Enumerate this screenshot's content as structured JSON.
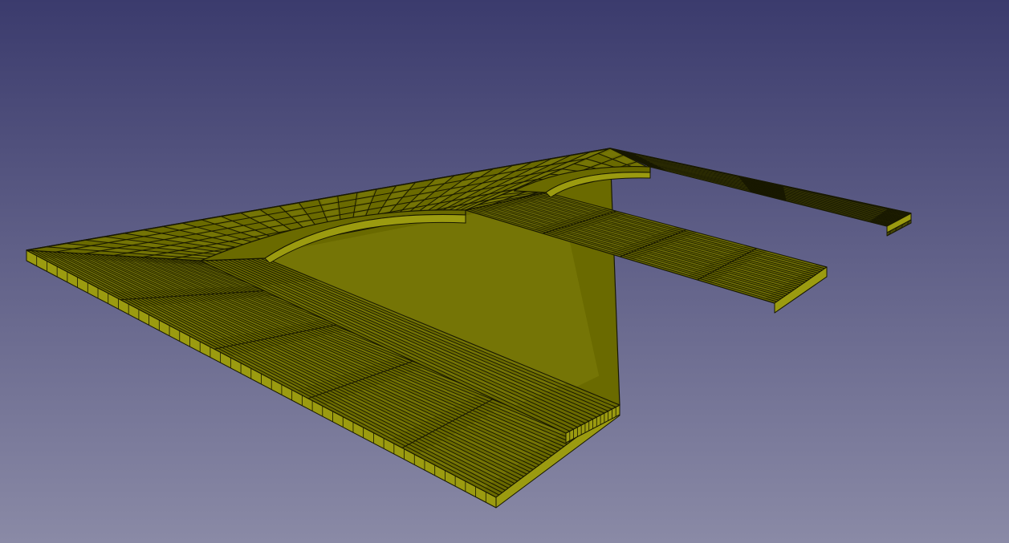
{
  "viewport": {
    "background_top": "#3b3b6d",
    "background_bottom": "#8a8aa6"
  },
  "model": {
    "kind": "track-bed-yard",
    "shape": "three-prong-trestle",
    "face_color": "#6a6a00",
    "face_highlight": "#8a8a12",
    "side_color": "#9b9b10",
    "edge_color": "#181800"
  }
}
